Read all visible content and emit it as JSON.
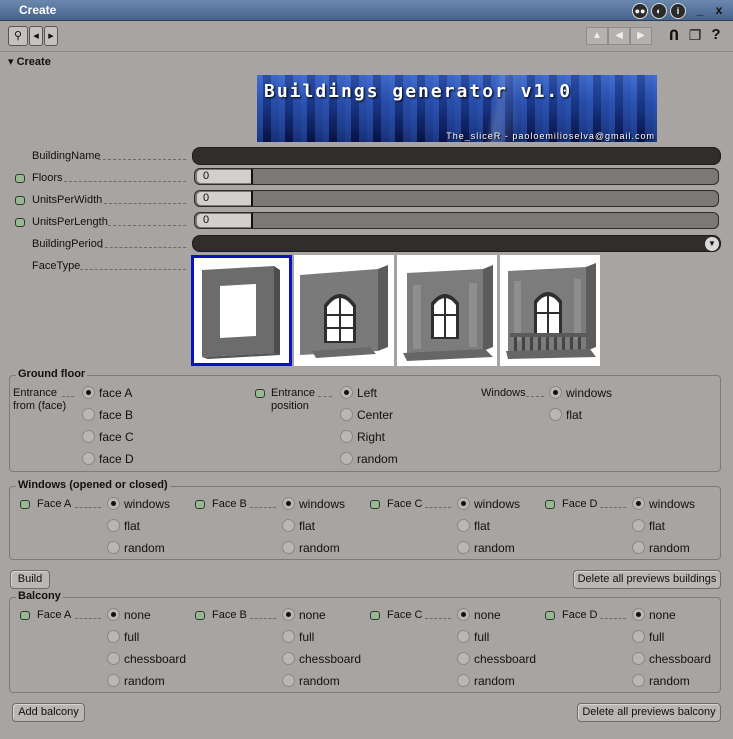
{
  "window": {
    "title": "Create"
  },
  "section": {
    "header": "Create"
  },
  "banner": {
    "title": "Buildings generator v1.0",
    "subtitle": "The_sliceR - paoloemilioselva@gmail.com"
  },
  "params": {
    "building_name": {
      "label": "BuildingName",
      "value": ""
    },
    "floors": {
      "label": "Floors",
      "value": "0"
    },
    "units_per_width": {
      "label": "UnitsPerWidth",
      "value": "0"
    },
    "units_per_length": {
      "label": "UnitsPerLength",
      "value": "0"
    },
    "building_period": {
      "label": "BuildingPeriod",
      "value": ""
    },
    "face_type": {
      "label": "FaceType"
    }
  },
  "ground_floor": {
    "title": "Ground floor",
    "entrance_from": {
      "label": "Entrance from (face)",
      "options": [
        "face A",
        "face B",
        "face C",
        "face D"
      ],
      "selected": 0
    },
    "entrance_position": {
      "label": "Entrance position",
      "options": [
        "Left",
        "Center",
        "Right",
        "random"
      ],
      "selected": 0
    },
    "windows": {
      "label": "Windows",
      "options": [
        "windows",
        "flat"
      ],
      "selected": 0
    }
  },
  "windows_group": {
    "title": "Windows (opened or closed)",
    "faces": [
      {
        "label": "Face A",
        "options": [
          "windows",
          "flat",
          "random"
        ],
        "selected": 0
      },
      {
        "label": "Face B",
        "options": [
          "windows",
          "flat",
          "random"
        ],
        "selected": 0
      },
      {
        "label": "Face C",
        "options": [
          "windows",
          "flat",
          "random"
        ],
        "selected": 0
      },
      {
        "label": "Face D",
        "options": [
          "windows",
          "flat",
          "random"
        ],
        "selected": 0
      }
    ]
  },
  "buttons": {
    "build": "Build",
    "delete_buildings": "Delete all previews buildings",
    "add_balcony": "Add balcony",
    "delete_balcony": "Delete all previews balcony"
  },
  "balcony_group": {
    "title": "Balcony",
    "faces": [
      {
        "label": "Face A",
        "options": [
          "none",
          "full",
          "chessboard",
          "random"
        ],
        "selected": 0
      },
      {
        "label": "Face B",
        "options": [
          "none",
          "full",
          "chessboard",
          "random"
        ],
        "selected": 0
      },
      {
        "label": "Face C",
        "options": [
          "none",
          "full",
          "chessboard",
          "random"
        ],
        "selected": 0
      },
      {
        "label": "Face D",
        "options": [
          "none",
          "full",
          "chessboard",
          "random"
        ],
        "selected": 0
      }
    ]
  },
  "colors": {
    "selection": "#0a10c8",
    "title_bar": "#5777a0",
    "panel": "#a7a4a1"
  }
}
